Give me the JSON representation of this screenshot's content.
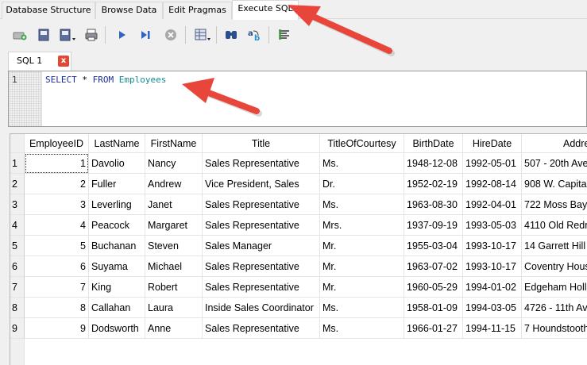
{
  "tabs": [
    "Database Structure",
    "Browse Data",
    "Edit Pragmas",
    "Execute SQL"
  ],
  "active_tab": "Execute SQL",
  "editor_tab": {
    "label": "SQL 1",
    "close_label": "x"
  },
  "editor": {
    "line_number": "1",
    "tokens": [
      "SELECT",
      " * ",
      "FROM",
      " ",
      "Employees"
    ]
  },
  "toolbar_icons": [
    "open-tab-icon",
    "open-sql-icon",
    "save-sql-icon",
    "print-icon",
    "execute-all-icon",
    "execute-line-icon",
    "stop-icon",
    "save-results-icon",
    "find-icon",
    "find-replace-icon",
    "comment-icon"
  ],
  "results": {
    "columns": [
      "EmployeeID",
      "LastName",
      "FirstName",
      "Title",
      "TitleOfCourtesy",
      "BirthDate",
      "HireDate",
      "Addre"
    ],
    "rows": [
      [
        "1",
        "1",
        "Davolio",
        "Nancy",
        "Sales Representative",
        "Ms.",
        "1948-12-08",
        "1992-05-01",
        "507 - 20th Ave"
      ],
      [
        "2",
        "2",
        "Fuller",
        "Andrew",
        "Vice President, Sales",
        "Dr.",
        "1952-02-19",
        "1992-08-14",
        "908 W. Capital"
      ],
      [
        "3",
        "3",
        "Leverling",
        "Janet",
        "Sales Representative",
        "Ms.",
        "1963-08-30",
        "1992-04-01",
        "722 Moss Bay"
      ],
      [
        "4",
        "4",
        "Peacock",
        "Margaret",
        "Sales Representative",
        "Mrs.",
        "1937-09-19",
        "1993-05-03",
        "4110 Old Redm"
      ],
      [
        "5",
        "5",
        "Buchanan",
        "Steven",
        "Sales Manager",
        "Mr.",
        "1955-03-04",
        "1993-10-17",
        "14 Garrett Hill"
      ],
      [
        "6",
        "6",
        "Suyama",
        "Michael",
        "Sales Representative",
        "Mr.",
        "1963-07-02",
        "1993-10-17",
        "Coventry Hous"
      ],
      [
        "7",
        "7",
        "King",
        "Robert",
        "Sales Representative",
        "Mr.",
        "1960-05-29",
        "1994-01-02",
        "Edgeham Hollo"
      ],
      [
        "8",
        "8",
        "Callahan",
        "Laura",
        "Inside Sales Coordinator",
        "Ms.",
        "1958-01-09",
        "1994-03-05",
        "4726 - 11th Av"
      ],
      [
        "9",
        "9",
        "Dodsworth",
        "Anne",
        "Sales Representative",
        "Ms.",
        "1966-01-27",
        "1994-11-15",
        "7 Houndstooth"
      ]
    ]
  },
  "colors": {
    "keyword": "#1c2e99",
    "identifier": "#168b8b",
    "arrow": "#e8463a"
  }
}
